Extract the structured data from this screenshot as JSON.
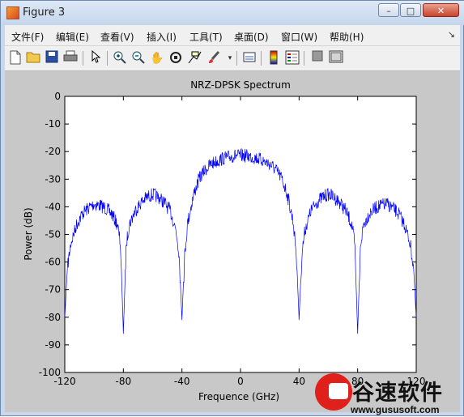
{
  "window": {
    "title": "Figure 3",
    "buttons": {
      "minimize": "–",
      "maximize": "□",
      "close": "✕"
    }
  },
  "menubar": {
    "items": [
      {
        "label": "文件(F)"
      },
      {
        "label": "编辑(E)"
      },
      {
        "label": "查看(V)"
      },
      {
        "label": "插入(I)"
      },
      {
        "label": "工具(T)"
      },
      {
        "label": "桌面(D)"
      },
      {
        "label": "窗口(W)"
      },
      {
        "label": "帮助(H)"
      }
    ],
    "overflow_arrow": "↘"
  },
  "toolbar": {
    "icons": [
      "new-figure-icon",
      "open-file-icon",
      "save-icon",
      "print-icon",
      "pointer-icon",
      "zoom-in-icon",
      "zoom-out-icon",
      "pan-icon",
      "rotate-3d-icon",
      "data-cursor-icon",
      "brush-icon",
      "link-icon",
      "colorbar-icon",
      "legend-icon",
      "hide-plot-tools-icon",
      "show-plot-tools-icon"
    ]
  },
  "chart_data": {
    "type": "line",
    "title": "NRZ-DPSK Spectrum",
    "xlabel": "Frequence (GHz)",
    "ylabel": "Power (dB)",
    "xlim": [
      -120,
      120
    ],
    "ylim": [
      -100,
      0
    ],
    "xticks": [
      -120,
      -80,
      -40,
      0,
      40,
      80,
      120
    ],
    "yticks": [
      0,
      -10,
      -20,
      -30,
      -40,
      -50,
      -60,
      -70,
      -80,
      -90,
      -100
    ],
    "grid": false,
    "series": [
      {
        "color": "#0000ff",
        "x": [
          -120,
          -118,
          -116,
          -112,
          -108,
          -104,
          -100,
          -96,
          -92,
          -88,
          -84,
          -82,
          -80,
          -78,
          -76,
          -72,
          -68,
          -64,
          -60,
          -56,
          -52,
          -48,
          -44,
          -42,
          -40,
          -38,
          -36,
          -32,
          -28,
          -24,
          -20,
          -16,
          -12,
          -8,
          -4,
          0,
          4,
          8,
          12,
          16,
          20,
          24,
          28,
          32,
          36,
          38,
          40,
          42,
          44,
          48,
          52,
          56,
          60,
          64,
          68,
          72,
          76,
          78,
          80,
          82,
          84,
          88,
          92,
          96,
          100,
          104,
          108,
          112,
          116,
          118,
          120
        ],
        "y": [
          -80,
          -60,
          -52,
          -45,
          -41,
          -39,
          -37.5,
          -38,
          -39,
          -41,
          -45,
          -52,
          -86,
          -52,
          -45,
          -40,
          -37,
          -35,
          -34,
          -35,
          -37,
          -40,
          -47,
          -55,
          -81,
          -55,
          -44,
          -34,
          -28,
          -25,
          -23,
          -22,
          -21,
          -20.5,
          -20,
          -20,
          -20,
          -20.5,
          -21,
          -22,
          -23,
          -25,
          -28,
          -34,
          -44,
          -55,
          -81,
          -55,
          -47,
          -40,
          -37,
          -35,
          -34,
          -35,
          -37,
          -40,
          -45,
          -52,
          -86,
          -52,
          -45,
          -41,
          -39,
          -38,
          -37.5,
          -39,
          -41,
          -45,
          -52,
          -60,
          -80
        ]
      }
    ]
  },
  "watermark": {
    "brand": "谷速软件",
    "url": "www.gususoft.com"
  }
}
